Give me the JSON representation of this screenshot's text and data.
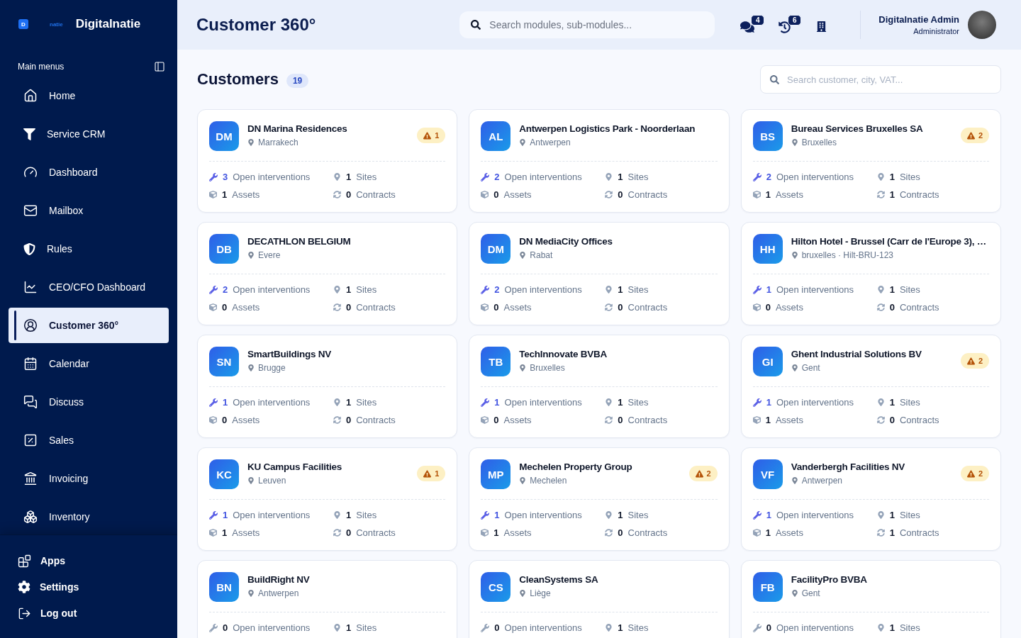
{
  "sidebar": {
    "logo": {
      "mark": "D",
      "tagline": "natie",
      "name": "Digitalnatie"
    },
    "section_title": "Main menus",
    "items": [
      {
        "label": "Home",
        "selected": false
      },
      {
        "label": "Service CRM",
        "selected": false
      },
      {
        "label": "Dashboard",
        "selected": false
      },
      {
        "label": "Mailbox",
        "selected": false
      },
      {
        "label": "Rules",
        "selected": false
      },
      {
        "label": "CEO/CFO Dashboard",
        "selected": false
      },
      {
        "label": "Customer 360°",
        "selected": true
      },
      {
        "label": "Calendar",
        "selected": false
      },
      {
        "label": "Discuss",
        "selected": false
      },
      {
        "label": "Sales",
        "selected": false
      },
      {
        "label": "Invoicing",
        "selected": false
      },
      {
        "label": "Inventory",
        "selected": false
      }
    ],
    "footer_items": [
      {
        "label": "Apps"
      },
      {
        "label": "Settings"
      },
      {
        "label": "Log out"
      }
    ]
  },
  "topbar": {
    "title": "Customer 360°",
    "search": {
      "placeholder": "Search modules, sub-modules..."
    },
    "actions": [
      {
        "kind": "messages",
        "count": "4"
      },
      {
        "kind": "history",
        "count": "6"
      },
      {
        "kind": "company"
      }
    ],
    "user": {
      "name": "Digitalnatie Admin",
      "role": "Administrator"
    }
  },
  "customers": {
    "title": "Customers",
    "count": "19",
    "search": {
      "placeholder": "Search customer, city, VAT..."
    },
    "cards": [
      {
        "initials": "DM",
        "name": "DN Marina Residences",
        "location": "Marrakech",
        "warning": "1",
        "stats": [
          {
            "kind": "interventions",
            "count": "3",
            "label": "Open interventions",
            "highlighted": true
          },
          {
            "kind": "sites",
            "count": "1",
            "label": "Sites",
            "highlighted": false
          },
          {
            "kind": "assets",
            "count": "1",
            "label": "Assets",
            "highlighted": false
          },
          {
            "kind": "contracts",
            "count": "0",
            "label": "Contracts",
            "highlighted": false
          }
        ]
      },
      {
        "initials": "AL",
        "name": "Antwerpen Logistics Park - Noorderlaan",
        "location": "Antwerpen",
        "stats": [
          {
            "kind": "interventions",
            "count": "2",
            "label": "Open interventions",
            "highlighted": true
          },
          {
            "kind": "sites",
            "count": "1",
            "label": "Sites",
            "highlighted": false
          },
          {
            "kind": "assets",
            "count": "0",
            "label": "Assets",
            "highlighted": false
          },
          {
            "kind": "contracts",
            "count": "0",
            "label": "Contracts",
            "highlighted": false
          }
        ]
      },
      {
        "initials": "BS",
        "name": "Bureau Services Bruxelles SA",
        "location": "Bruxelles",
        "warning": "2",
        "stats": [
          {
            "kind": "interventions",
            "count": "2",
            "label": "Open interventions",
            "highlighted": true
          },
          {
            "kind": "sites",
            "count": "1",
            "label": "Sites",
            "highlighted": false
          },
          {
            "kind": "assets",
            "count": "1",
            "label": "Assets",
            "highlighted": false
          },
          {
            "kind": "contracts",
            "count": "1",
            "label": "Contracts",
            "highlighted": false
          }
        ]
      },
      {
        "initials": "DB",
        "name": "DECATHLON BELGIUM",
        "location": "Evere",
        "stats": [
          {
            "kind": "interventions",
            "count": "2",
            "label": "Open interventions",
            "highlighted": true
          },
          {
            "kind": "sites",
            "count": "1",
            "label": "Sites",
            "highlighted": false
          },
          {
            "kind": "assets",
            "count": "0",
            "label": "Assets",
            "highlighted": false
          },
          {
            "kind": "contracts",
            "count": "0",
            "label": "Contracts",
            "highlighted": false
          }
        ]
      },
      {
        "initials": "DM",
        "name": "DN MediaCity Offices",
        "location": "Rabat",
        "stats": [
          {
            "kind": "interventions",
            "count": "2",
            "label": "Open interventions",
            "highlighted": true
          },
          {
            "kind": "sites",
            "count": "1",
            "label": "Sites",
            "highlighted": false
          },
          {
            "kind": "assets",
            "count": "0",
            "label": "Assets",
            "highlighted": false
          },
          {
            "kind": "contracts",
            "count": "0",
            "label": "Contracts",
            "highlighted": false
          }
        ]
      },
      {
        "initials": "HH",
        "name": "Hilton Hotel - Brussel (Carr de l'Europe 3), …",
        "location": "bruxelles · Hilt-BRU-123",
        "stats": [
          {
            "kind": "interventions",
            "count": "1",
            "label": "Open interventions",
            "highlighted": true
          },
          {
            "kind": "sites",
            "count": "1",
            "label": "Sites",
            "highlighted": false
          },
          {
            "kind": "assets",
            "count": "0",
            "label": "Assets",
            "highlighted": false
          },
          {
            "kind": "contracts",
            "count": "0",
            "label": "Contracts",
            "highlighted": false
          }
        ]
      },
      {
        "initials": "SN",
        "name": "SmartBuildings NV",
        "location": "Brugge",
        "stats": [
          {
            "kind": "interventions",
            "count": "1",
            "label": "Open interventions",
            "highlighted": true
          },
          {
            "kind": "sites",
            "count": "1",
            "label": "Sites",
            "highlighted": false
          },
          {
            "kind": "assets",
            "count": "0",
            "label": "Assets",
            "highlighted": false
          },
          {
            "kind": "contracts",
            "count": "0",
            "label": "Contracts",
            "highlighted": false
          }
        ]
      },
      {
        "initials": "TB",
        "name": "TechInnovate BVBA",
        "location": "Bruxelles",
        "stats": [
          {
            "kind": "interventions",
            "count": "1",
            "label": "Open interventions",
            "highlighted": true
          },
          {
            "kind": "sites",
            "count": "1",
            "label": "Sites",
            "highlighted": false
          },
          {
            "kind": "assets",
            "count": "0",
            "label": "Assets",
            "highlighted": false
          },
          {
            "kind": "contracts",
            "count": "0",
            "label": "Contracts",
            "highlighted": false
          }
        ]
      },
      {
        "initials": "GI",
        "name": "Ghent Industrial Solutions BV",
        "location": "Gent",
        "warning": "2",
        "stats": [
          {
            "kind": "interventions",
            "count": "1",
            "label": "Open interventions",
            "highlighted": true
          },
          {
            "kind": "sites",
            "count": "1",
            "label": "Sites",
            "highlighted": false
          },
          {
            "kind": "assets",
            "count": "1",
            "label": "Assets",
            "highlighted": false
          },
          {
            "kind": "contracts",
            "count": "0",
            "label": "Contracts",
            "highlighted": false
          }
        ]
      },
      {
        "initials": "KC",
        "name": "KU Campus Facilities",
        "location": "Leuven",
        "warning": "1",
        "stats": [
          {
            "kind": "interventions",
            "count": "1",
            "label": "Open interventions",
            "highlighted": true
          },
          {
            "kind": "sites",
            "count": "1",
            "label": "Sites",
            "highlighted": false
          },
          {
            "kind": "assets",
            "count": "1",
            "label": "Assets",
            "highlighted": false
          },
          {
            "kind": "contracts",
            "count": "0",
            "label": "Contracts",
            "highlighted": false
          }
        ]
      },
      {
        "initials": "MP",
        "name": "Mechelen Property Group",
        "location": "Mechelen",
        "warning": "2",
        "stats": [
          {
            "kind": "interventions",
            "count": "1",
            "label": "Open interventions",
            "highlighted": true
          },
          {
            "kind": "sites",
            "count": "1",
            "label": "Sites",
            "highlighted": false
          },
          {
            "kind": "assets",
            "count": "1",
            "label": "Assets",
            "highlighted": false
          },
          {
            "kind": "contracts",
            "count": "0",
            "label": "Contracts",
            "highlighted": false
          }
        ]
      },
      {
        "initials": "VF",
        "name": "Vanderbergh Facilities NV",
        "location": "Antwerpen",
        "warning": "2",
        "stats": [
          {
            "kind": "interventions",
            "count": "1",
            "label": "Open interventions",
            "highlighted": true
          },
          {
            "kind": "sites",
            "count": "1",
            "label": "Sites",
            "highlighted": false
          },
          {
            "kind": "assets",
            "count": "1",
            "label": "Assets",
            "highlighted": false
          },
          {
            "kind": "contracts",
            "count": "1",
            "label": "Contracts",
            "highlighted": false
          }
        ]
      },
      {
        "initials": "BN",
        "name": "BuildRight NV",
        "location": "Antwerpen",
        "stats": [
          {
            "kind": "interventions",
            "count": "0",
            "label": "Open interventions",
            "highlighted": false
          },
          {
            "kind": "sites",
            "count": "1",
            "label": "Sites",
            "highlighted": false
          }
        ]
      },
      {
        "initials": "CS",
        "name": "CleanSystems SA",
        "location": "Liège",
        "stats": [
          {
            "kind": "interventions",
            "count": "0",
            "label": "Open interventions",
            "highlighted": false
          },
          {
            "kind": "sites",
            "count": "1",
            "label": "Sites",
            "highlighted": false
          }
        ]
      },
      {
        "initials": "FB",
        "name": "FacilityPro BVBA",
        "location": "Gent",
        "stats": [
          {
            "kind": "interventions",
            "count": "0",
            "label": "Open interventions",
            "highlighted": false
          },
          {
            "kind": "sites",
            "count": "1",
            "label": "Sites",
            "highlighted": false
          }
        ]
      }
    ]
  }
}
